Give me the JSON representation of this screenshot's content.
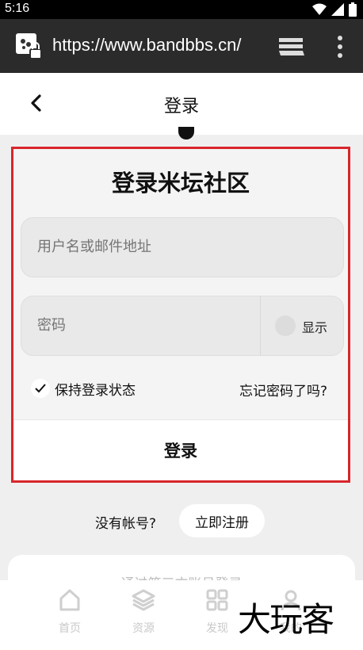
{
  "status_bar": {
    "time": "5:16"
  },
  "browser": {
    "url": "https://www.bandbbs.cn/"
  },
  "nav": {
    "title": "登录"
  },
  "login": {
    "heading": "登录米坛社区",
    "username_placeholder": "用户名或邮件地址",
    "password_placeholder": "密码",
    "show_password_label": "显示",
    "remember_label": "保持登录状态",
    "forgot_label": "忘记密码了吗?",
    "submit_label": "登录"
  },
  "register": {
    "prompt": "没有帐号?",
    "button_label": "立即注册"
  },
  "third_party": {
    "label": "通过第三方账号登录"
  },
  "tabbar": {
    "items": [
      {
        "label": "首页",
        "icon": "home-icon"
      },
      {
        "label": "资源",
        "icon": "layers-icon"
      },
      {
        "label": "发现",
        "icon": "grid-icon"
      },
      {
        "label": "我的",
        "icon": "user-icon"
      }
    ]
  },
  "watermark": {
    "text": "大玩客"
  },
  "colors": {
    "highlight_border": "#d8262b",
    "url_bar": "#2b2b2b",
    "status_bar": "#000000"
  }
}
